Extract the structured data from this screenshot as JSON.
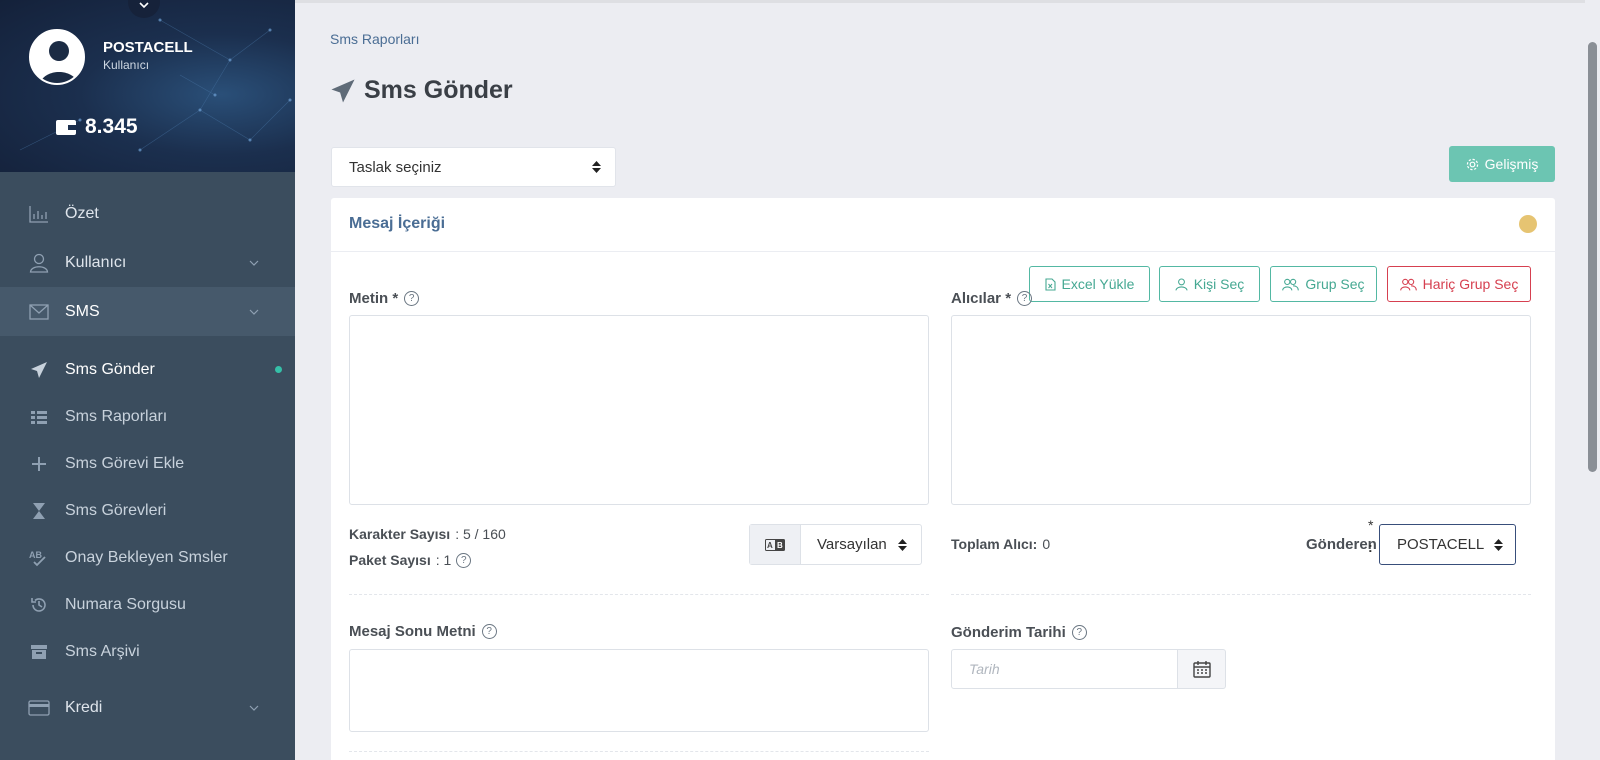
{
  "sidebar": {
    "user_name": "POSTACELL",
    "user_role": "Kullanıcı",
    "balance": "8.345",
    "menu": [
      {
        "label": "Özet",
        "icon": "chart-icon"
      },
      {
        "label": "Kullanıcı",
        "icon": "user-icon"
      },
      {
        "label": "SMS",
        "icon": "mail-icon"
      }
    ],
    "sms_items": [
      {
        "label": "Sms Gönder",
        "icon": "send-icon"
      },
      {
        "label": "Sms Raporları",
        "icon": "list-icon"
      },
      {
        "label": "Sms Görevi Ekle",
        "icon": "plus-icon"
      },
      {
        "label": "Sms Görevleri",
        "icon": "hourglass-icon"
      },
      {
        "label": "Onay Bekleyen Smsler",
        "icon": "spellcheck-icon"
      },
      {
        "label": "Numara Sorgusu",
        "icon": "history-icon"
      },
      {
        "label": "Sms Arşivi",
        "icon": "archive-icon"
      }
    ],
    "kredi": "Kredi"
  },
  "breadcrumb": "Sms Raporları",
  "page_title": "Sms Gönder",
  "draft_select": "Taslak seçiniz",
  "advanced_button": "Gelişmiş",
  "card": {
    "title": "Mesaj İçeriği",
    "text_label": "Metin *",
    "recipients_label": "Alıcılar *",
    "buttons": {
      "excel": "Excel Yükle",
      "person": "Kişi Seç",
      "group": "Grup Seç",
      "exclude_group": "Hariç Grup Seç"
    },
    "char_count_label": "Karakter Sayısı",
    "char_count_value": ": 5 / 160",
    "package_count_label": "Paket Sayısı",
    "package_count_value": ": 1",
    "language_select": "Varsayılan",
    "total_recipients_label": "Toplam Alıcı:",
    "total_recipients_value": "0",
    "sender_label": "Gönderen",
    "sender_required": "*",
    "sender_colon": ":",
    "sender_select": "POSTACELL",
    "footer_text_label": "Mesaj Sonu Metni",
    "send_date_label": "Gönderim Tarihi",
    "date_placeholder": "Tarih"
  },
  "colors": {
    "sidebar_bg": "#3b4d5e",
    "accent_teal": "#6cc5b2",
    "danger": "#d64050",
    "link": "#4a6d94",
    "status_dot": "#e6c472"
  }
}
